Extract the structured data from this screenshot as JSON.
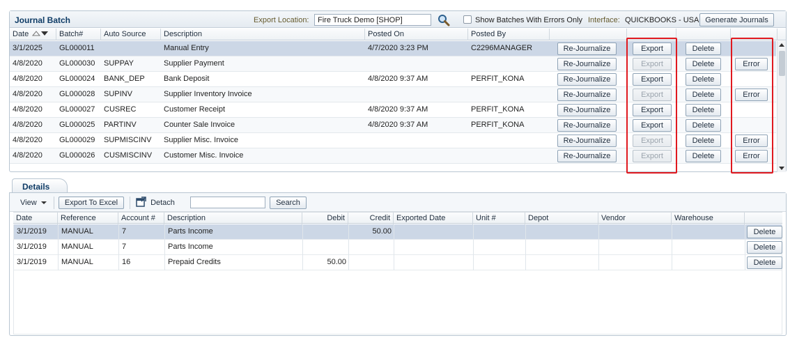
{
  "journal_batch": {
    "title": "Journal Batch",
    "export_location_label": "Export Location:",
    "export_location_value": "Fire Truck Demo [SHOP]",
    "errors_only_label": "Show Batches With Errors Only",
    "interface_label": "Interface:",
    "interface_value": "QUICKBOOKS - USA",
    "generate_label": "Generate Journals",
    "columns": [
      "Date",
      "Batch#",
      "Auto Source",
      "Description",
      "Posted On",
      "Posted By"
    ],
    "rejournalize_label": "Re-Journalize",
    "export_label": "Export",
    "delete_label": "Delete",
    "error_label": "Error",
    "rows": [
      {
        "date": "3/1/2025",
        "batch": "GL000011",
        "source": "",
        "description": "Manual Entry",
        "posted_on": "4/7/2020 3:23 PM",
        "posted_by": "C2296MANAGER",
        "export_enabled": true,
        "error": false
      },
      {
        "date": "4/8/2020",
        "batch": "GL000030",
        "source": "SUPPAY",
        "description": "Supplier Payment",
        "posted_on": "",
        "posted_by": "",
        "export_enabled": false,
        "error": true
      },
      {
        "date": "4/8/2020",
        "batch": "GL000024",
        "source": "BANK_DEP",
        "description": "Bank Deposit",
        "posted_on": "4/8/2020 9:37 AM",
        "posted_by": "PERFIT_KONA",
        "export_enabled": true,
        "error": false
      },
      {
        "date": "4/8/2020",
        "batch": "GL000028",
        "source": "SUPINV",
        "description": "Supplier Inventory Invoice",
        "posted_on": "",
        "posted_by": "",
        "export_enabled": false,
        "error": true
      },
      {
        "date": "4/8/2020",
        "batch": "GL000027",
        "source": "CUSREC",
        "description": "Customer Receipt",
        "posted_on": "4/8/2020 9:37 AM",
        "posted_by": "PERFIT_KONA",
        "export_enabled": true,
        "error": false
      },
      {
        "date": "4/8/2020",
        "batch": "GL000025",
        "source": "PARTINV",
        "description": "Counter Sale Invoice",
        "posted_on": "4/8/2020 9:37 AM",
        "posted_by": "PERFIT_KONA",
        "export_enabled": true,
        "error": false
      },
      {
        "date": "4/8/2020",
        "batch": "GL000029",
        "source": "SUPMISCINV",
        "description": "Supplier Misc. Invoice",
        "posted_on": "",
        "posted_by": "",
        "export_enabled": false,
        "error": true
      },
      {
        "date": "4/8/2020",
        "batch": "GL000026",
        "source": "CUSMISCINV",
        "description": "Customer Misc. Invoice",
        "posted_on": "",
        "posted_by": "",
        "export_enabled": false,
        "error": true
      }
    ]
  },
  "details": {
    "tab_label": "Details",
    "view_label": "View",
    "export_excel_label": "Export To Excel",
    "detach_label": "Detach",
    "search_value": "",
    "search_label": "Search",
    "columns": [
      "Date",
      "Reference",
      "Account #",
      "Description",
      "Debit",
      "Credit",
      "Exported Date",
      "Unit #",
      "Depot",
      "Vendor",
      "Warehouse"
    ],
    "delete_label": "Delete",
    "rows": [
      {
        "date": "3/1/2019",
        "reference": "MANUAL",
        "account": "7",
        "description": "Parts Income",
        "debit": "",
        "credit": "50.00"
      },
      {
        "date": "3/1/2019",
        "reference": "MANUAL",
        "account": "7",
        "description": "Parts Income",
        "debit": "",
        "credit": ""
      },
      {
        "date": "3/1/2019",
        "reference": "MANUAL",
        "account": "16",
        "description": "Prepaid Credits",
        "debit": "50.00",
        "credit": ""
      }
    ]
  }
}
